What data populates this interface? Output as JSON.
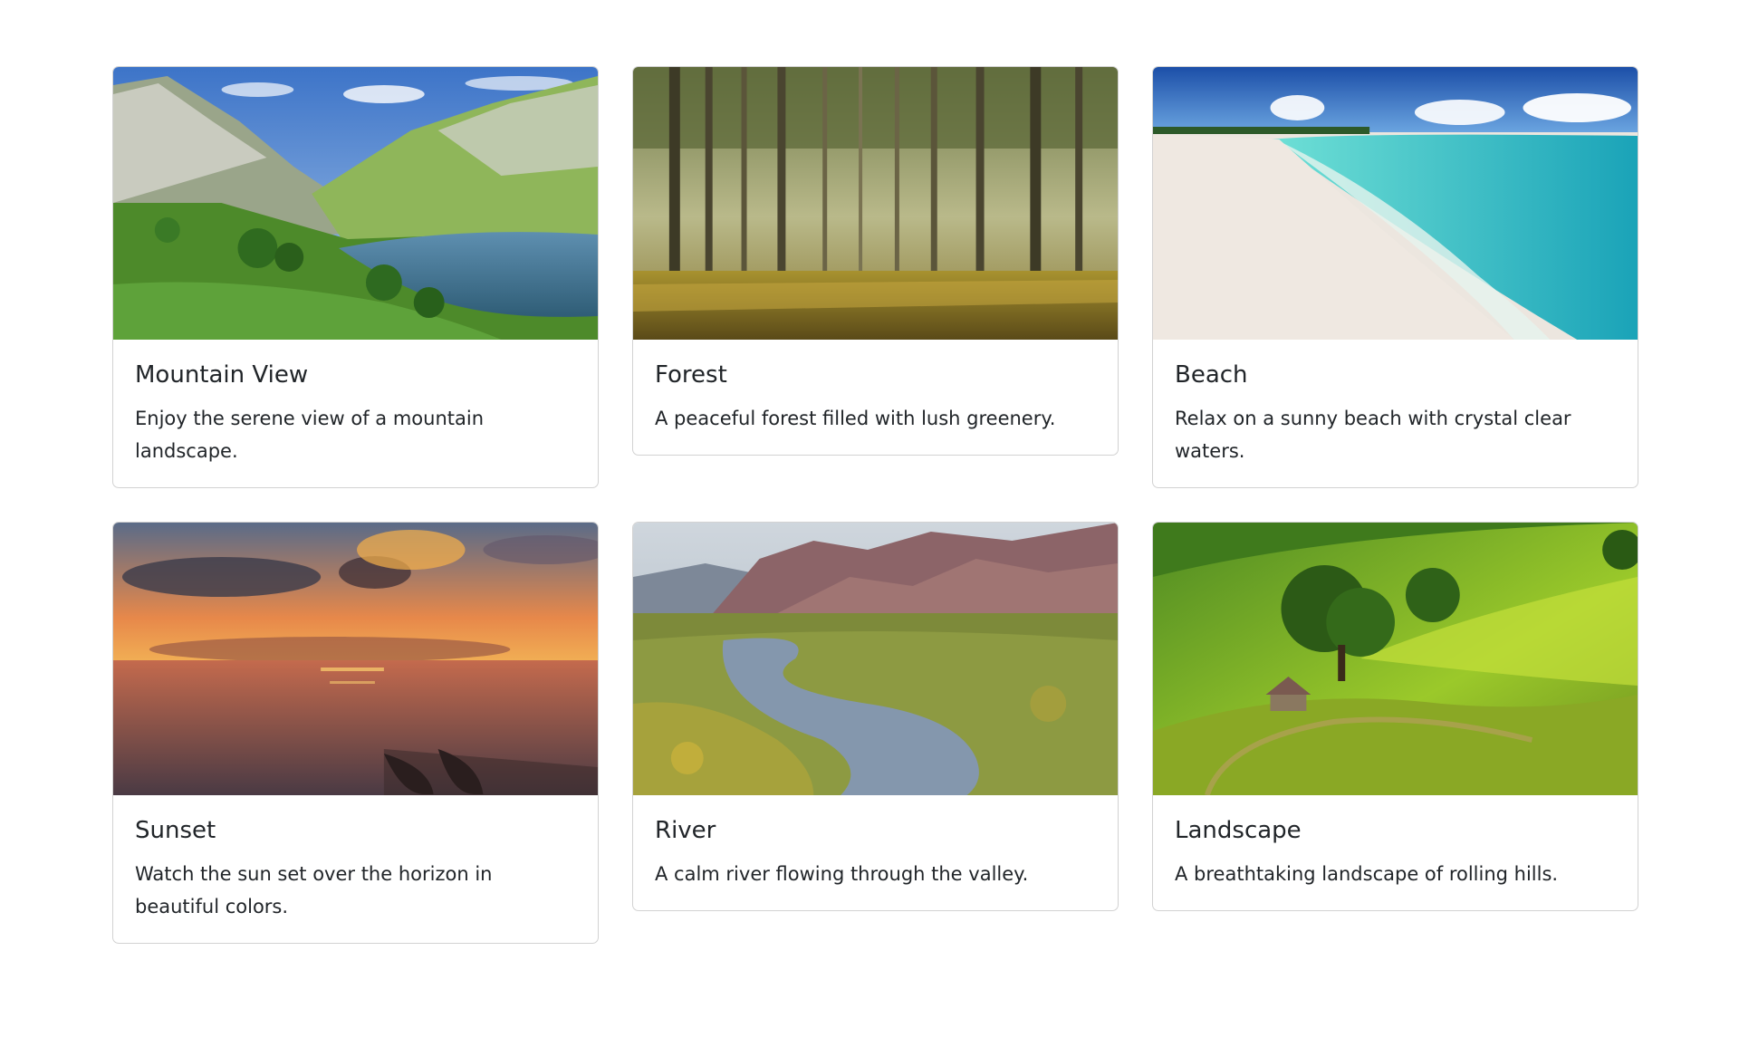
{
  "cards": [
    {
      "title": "Mountain View",
      "text": "Enjoy the serene view of a mountain landscape.",
      "image_subject": "mountain-lake"
    },
    {
      "title": "Forest",
      "text": "A peaceful forest filled with lush greenery.",
      "image_subject": "forest"
    },
    {
      "title": "Beach",
      "text": "Relax on a sunny beach with crystal clear waters.",
      "image_subject": "beach"
    },
    {
      "title": "Sunset",
      "text": "Watch the sun set over the horizon in beautiful colors.",
      "image_subject": "sunset-sea"
    },
    {
      "title": "River",
      "text": "A calm river flowing through the valley.",
      "image_subject": "river-valley"
    },
    {
      "title": "Landscape",
      "text": "A breathtaking landscape of rolling hills.",
      "image_subject": "rolling-hills"
    }
  ]
}
